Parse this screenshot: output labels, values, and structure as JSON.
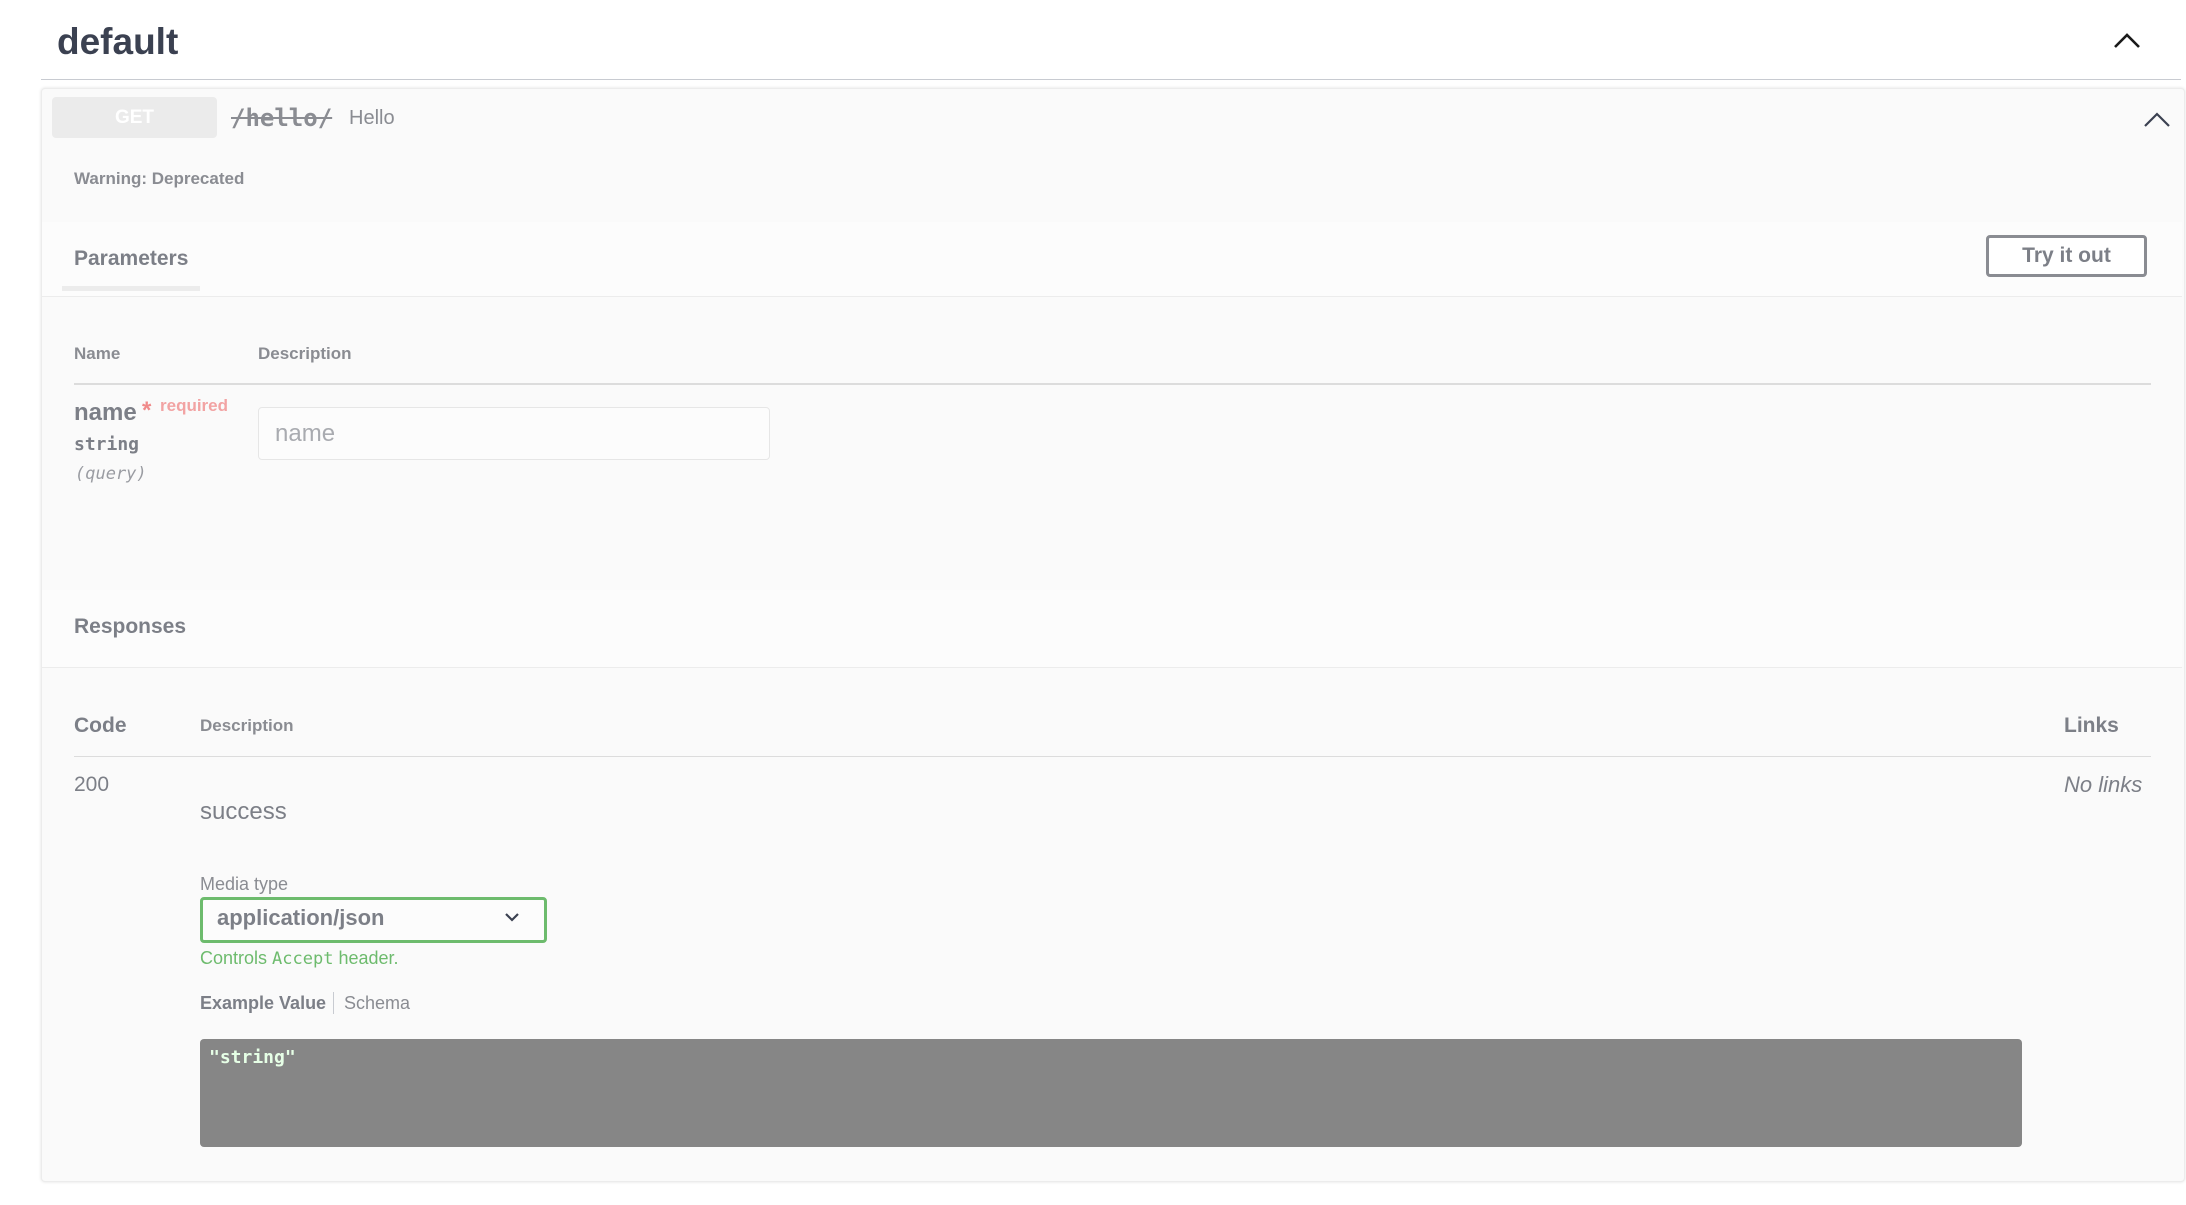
{
  "tag": {
    "title": "default"
  },
  "operation": {
    "method": "GET",
    "path": "/hello/",
    "summary": "Hello",
    "warning": "Warning: Deprecated"
  },
  "parameters": {
    "title": "Parameters",
    "try_label": "Try it out",
    "col_name": "Name",
    "col_description": "Description",
    "items": [
      {
        "name": "name",
        "required_star": "*",
        "required": "required",
        "type": "string",
        "in": "(query)",
        "placeholder": "name",
        "value": ""
      }
    ]
  },
  "responses": {
    "title": "Responses",
    "col_code": "Code",
    "col_description": "Description",
    "col_links": "Links",
    "items": [
      {
        "code": "200",
        "description": "success",
        "links": "No links",
        "media_type_label": "Media type",
        "media_type": "application/json",
        "hint_prefix": "Controls ",
        "hint_code": "Accept",
        "hint_suffix": " header.",
        "example_tab": "Example Value",
        "schema_tab": "Schema",
        "example": "\"string\""
      }
    ]
  },
  "icons": {
    "tag_toggle": "chevron-up-icon",
    "op_toggle": "chevron-up-icon",
    "select_arrow": "chevron-down-icon"
  },
  "colors": {
    "select_border": "#6dbb6d",
    "required": "#f08a8a",
    "code_bg": "#868686"
  }
}
